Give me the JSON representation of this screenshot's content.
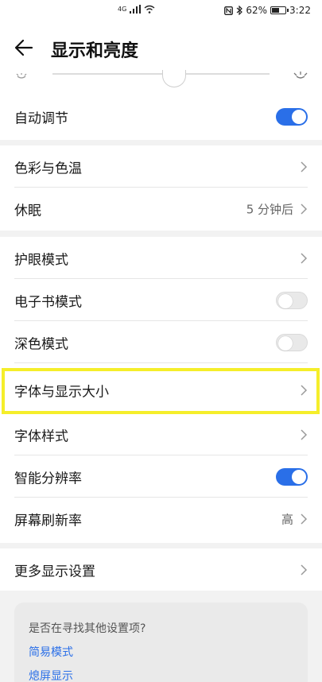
{
  "status_bar": {
    "signal_label": "4G",
    "battery_percent": "62%",
    "time": "3:22",
    "battery_level": 0.62
  },
  "header": {
    "title": "显示和亮度"
  },
  "settings": {
    "auto_adjust": {
      "label": "自动调节",
      "enabled": true
    },
    "color_temp": {
      "label": "色彩与色温"
    },
    "sleep": {
      "label": "休眠",
      "value": "5 分钟后"
    },
    "eye_comfort": {
      "label": "护眼模式"
    },
    "ebook_mode": {
      "label": "电子书模式",
      "enabled": false
    },
    "dark_mode": {
      "label": "深色模式",
      "enabled": false
    },
    "font_size": {
      "label": "字体与显示大小"
    },
    "font_style": {
      "label": "字体样式"
    },
    "smart_resolution": {
      "label": "智能分辨率",
      "enabled": true
    },
    "refresh_rate": {
      "label": "屏幕刷新率",
      "value": "高"
    },
    "more_display": {
      "label": "更多显示设置"
    }
  },
  "tip": {
    "title": "是否在寻找其他设置项?",
    "links": [
      "简易模式",
      "熄屏显示"
    ]
  },
  "colors": {
    "accent": "#2a6fe8",
    "highlight": "#f5ee2a"
  }
}
